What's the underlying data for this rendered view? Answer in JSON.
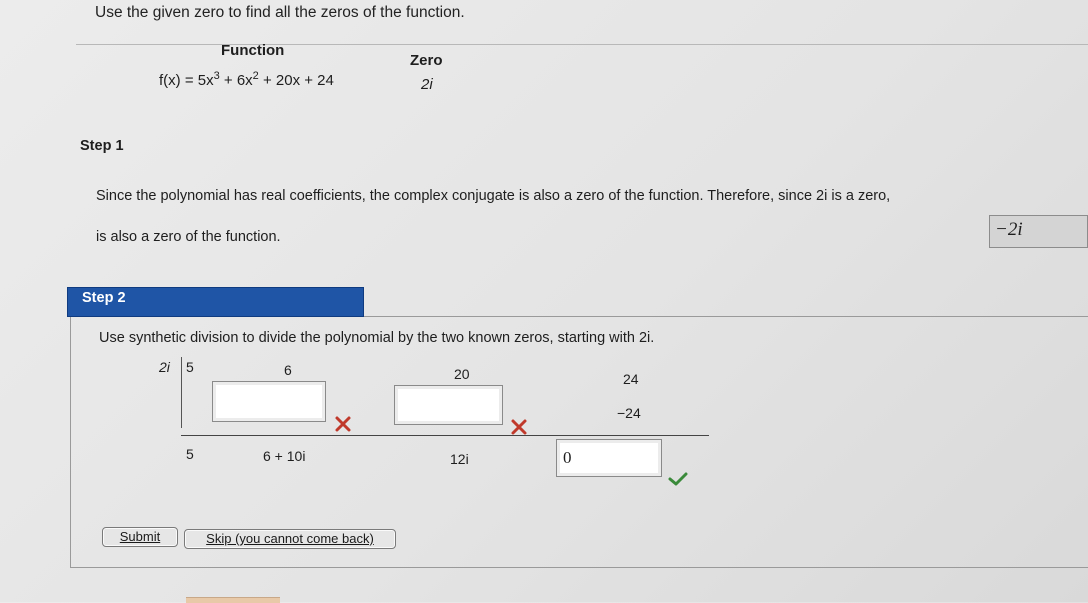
{
  "problem": {
    "instruction": "Use the given zero to find all the zeros of the function.",
    "function_header": "Function",
    "zero_header": "Zero",
    "function_expr_prefix": "f(x) = 5x",
    "function_exp1": "3",
    "function_mid": " + 6x",
    "function_exp2": "2",
    "function_suffix": " + 20x + 24",
    "zero_value": "2i"
  },
  "step1": {
    "label": "Step 1",
    "text_line1": "Since the polynomial has real coefficients, the complex conjugate is also a zero of the function. Therefore, since 2i is a zero,",
    "text_line2": "is also a zero of the function.",
    "answer_value": "−2i"
  },
  "step2": {
    "label": "Step 2",
    "instruction": "Use synthetic division to divide the polynomial by the two known zeros, starting with 2i.",
    "divisor": "2i",
    "top_row": [
      "5",
      "6",
      "20",
      "24"
    ],
    "middle_given": "−24",
    "bottom_row": [
      "5",
      "6 + 10i",
      "12i"
    ],
    "remainder_value": "0",
    "colors": {
      "incorrect": "#c0392b",
      "correct": "#3a8a3a",
      "step_tab": "#1f55a6"
    }
  },
  "buttons": {
    "submit": "Submit",
    "skip": "Skip (you cannot come back)"
  }
}
